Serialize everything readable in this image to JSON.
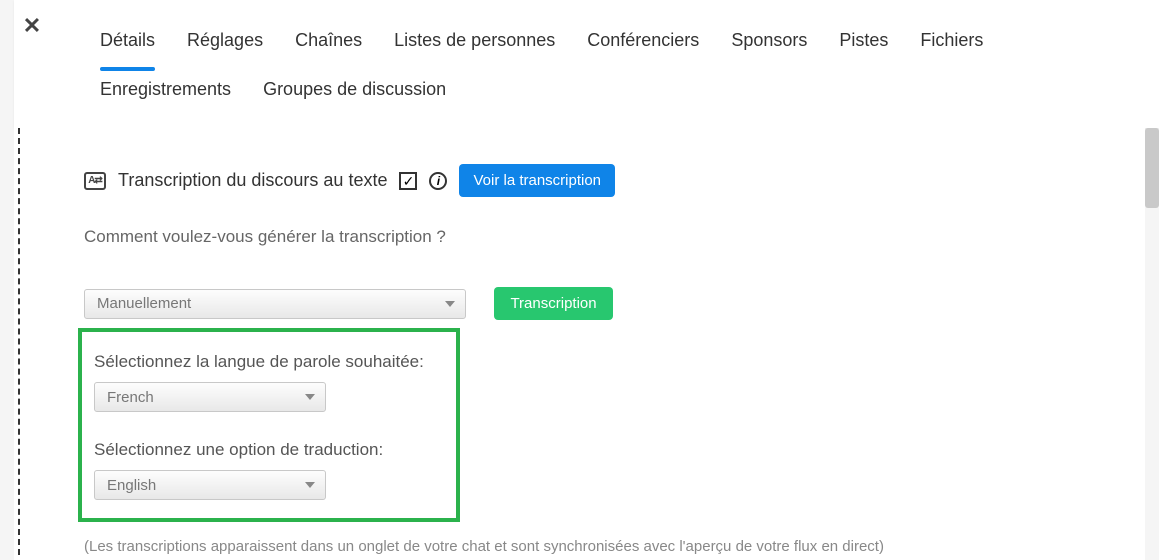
{
  "close_icon_glyph": "✕",
  "tabs_row1": [
    {
      "label": "Détails",
      "active": true
    },
    {
      "label": "Réglages"
    },
    {
      "label": "Chaînes"
    },
    {
      "label": "Listes de personnes"
    },
    {
      "label": "Conférenciers"
    },
    {
      "label": "Sponsors"
    },
    {
      "label": "Pistes"
    },
    {
      "label": "Fichiers"
    }
  ],
  "tabs_row2": [
    {
      "label": "Enregistrements"
    },
    {
      "label": "Groupes de discussion"
    }
  ],
  "section": {
    "icon_glyph": "A⇄",
    "title": "Transcription du discours au texte",
    "checked_glyph": "✓",
    "info_glyph": "i",
    "view_button": "Voir la transcription"
  },
  "generation": {
    "label": "Comment voulez-vous générer la transcription ?",
    "selected": "Manuellement"
  },
  "transcription_button": "Transcription",
  "languages": {
    "speech_label": "Sélectionnez la langue de parole souhaitée:",
    "speech_selected": "French",
    "translate_label": "Sélectionnez une option de traduction:",
    "translate_selected": "English"
  },
  "hint": "(Les transcriptions apparaissent dans un onglet de votre chat et sont synchronisées avec l'aperçu de votre flux en direct)"
}
